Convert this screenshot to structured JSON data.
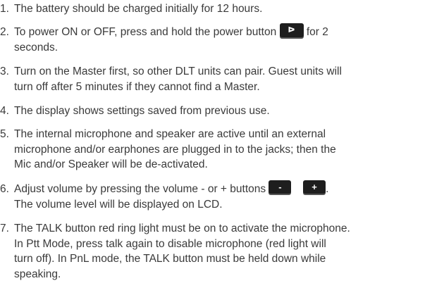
{
  "items": [
    {
      "number": "1.",
      "lines": [
        "The battery should be charged initially for 12 hours."
      ]
    },
    {
      "number": "2.",
      "line1_before": "To power ON or OFF, press and hold the power button",
      "icon_label": "ᐅ",
      "line1_after": "for 2",
      "line2": "seconds."
    },
    {
      "number": "3.",
      "lines": [
        "Turn on the Master first, so other DLT units can pair.  Guest units will",
        "turn off after 5 minutes if they cannot find a Master."
      ]
    },
    {
      "number": "4.",
      "lines": [
        "The display shows settings saved from previous use."
      ]
    },
    {
      "number": "5.",
      "lines": [
        "The internal microphone and speaker are active until an external",
        "microphone and/or earphones are plugged in to the jacks; then the",
        "Mic and/or Speaker will be de-activated."
      ]
    },
    {
      "number": "6.",
      "line1_before": "Adjust volume by pressing the volume - or + buttons",
      "minus_label": "-",
      "plus_label": "+",
      "line1_after": ".",
      "line2": "The volume level will be displayed on LCD."
    },
    {
      "number": "7.",
      "lines": [
        "The TALK button red ring light must be on to activate the microphone.",
        "In Ptt Mode, press talk again to disable microphone (red light will",
        "turn off).  In PnL mode, the TALK button must be held down while",
        "speaking."
      ]
    }
  ]
}
